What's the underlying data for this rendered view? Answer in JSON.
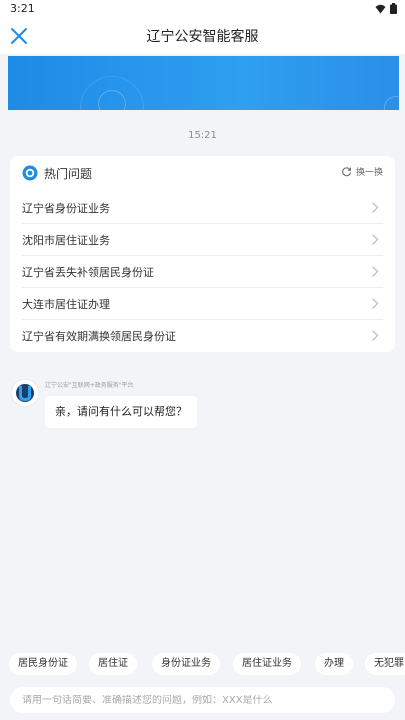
{
  "status_bar": {
    "time": "3:21"
  },
  "nav": {
    "title": "辽宁公安智能客服"
  },
  "chat": {
    "timestamp": "15:21"
  },
  "faq": {
    "title": "热门问题",
    "refresh_label": "换一换",
    "items": [
      {
        "label": "辽宁省身份证业务"
      },
      {
        "label": "沈阳市居住证业务"
      },
      {
        "label": "辽宁省丢失补领居民身份证"
      },
      {
        "label": "大连市居住证办理"
      },
      {
        "label": "辽宁省有效期满换领居民身份证"
      }
    ]
  },
  "bot": {
    "name": "辽宁公安\"互联网+政务服务\"平台",
    "greeting": "亲，请问有什么可以帮您？"
  },
  "quick_tags": [
    {
      "label": "居民身份证"
    },
    {
      "label": "居住证"
    },
    {
      "label": "身份证业务"
    },
    {
      "label": "居住证业务"
    },
    {
      "label": "办理"
    },
    {
      "label": "无犯罪"
    }
  ],
  "input": {
    "placeholder": "请用一句话简要、准确描述您的问题，例如：XXX是什么"
  },
  "colors": {
    "accent": "#1e8be6",
    "background": "#f3f4f7"
  },
  "icons": [
    "close-icon",
    "wifi-icon",
    "battery-icon",
    "hot-question-icon",
    "refresh-icon",
    "chevron-right-icon"
  ]
}
